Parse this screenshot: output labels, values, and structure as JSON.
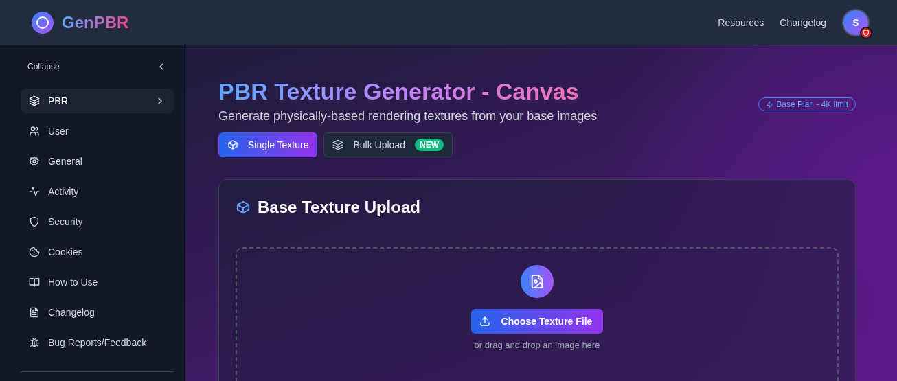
{
  "header": {
    "logo_text": "GenPBR",
    "nav": [
      "Resources",
      "Changelog"
    ],
    "avatar_initial": "S"
  },
  "sidebar": {
    "collapse_label": "Collapse",
    "items": [
      {
        "label": "PBR",
        "selected": true,
        "has_submenu": true
      },
      {
        "label": "User",
        "selected": false,
        "has_submenu": false
      },
      {
        "label": "General",
        "selected": false,
        "has_submenu": false
      },
      {
        "label": "Activity",
        "selected": false,
        "has_submenu": false
      },
      {
        "label": "Security",
        "selected": false,
        "has_submenu": false
      },
      {
        "label": "Cookies",
        "selected": false,
        "has_submenu": false
      },
      {
        "label": "How to Use",
        "selected": false,
        "has_submenu": false
      },
      {
        "label": "Changelog",
        "selected": false,
        "has_submenu": false
      },
      {
        "label": "Bug Reports/Feedback",
        "selected": false,
        "has_submenu": false
      }
    ]
  },
  "main": {
    "title": "PBR Texture Generator - Canvas",
    "subtitle": "Generate physically-based rendering textures from your base images",
    "plan_badge": "Base Plan - 4K limit",
    "tabs": [
      {
        "label": "Single Texture",
        "selected": true
      },
      {
        "label": "Bulk Upload",
        "selected": false,
        "badge": "NEW"
      }
    ],
    "card": {
      "title": "Base Texture Upload",
      "button": "Choose Texture File",
      "hint": "or drag and drop an image here"
    }
  }
}
